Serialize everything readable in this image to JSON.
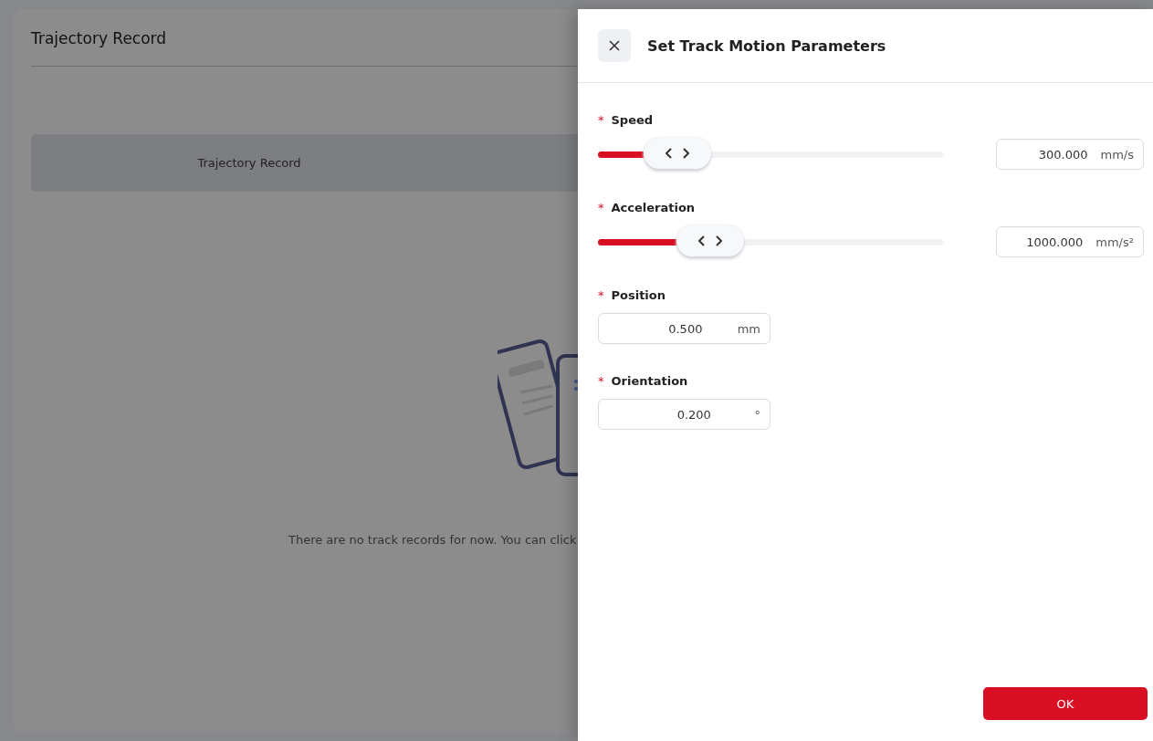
{
  "page": {
    "title": "Trajectory Record",
    "table": {
      "columns": [
        "Trajectory Record"
      ]
    },
    "empty_message": "There are no track records for now. You can click"
  },
  "drawer": {
    "title": "Set Track Motion Parameters",
    "required_mark": "*",
    "fields": [
      {
        "kind": "slider",
        "label": "Speed",
        "required": true,
        "level": 0.23,
        "value": "300.000",
        "unit": "mm/s"
      },
      {
        "kind": "slider",
        "label": "Acceleration",
        "required": true,
        "level": 0.325,
        "value": "1000.000",
        "unit": "mm/s²"
      },
      {
        "kind": "input",
        "label": "Position",
        "required": true,
        "value": "0.500",
        "unit": "mm"
      },
      {
        "kind": "input",
        "label": "Orientation",
        "required": true,
        "value": "0.200",
        "unit": "°"
      }
    ],
    "ok_button": "OK"
  }
}
